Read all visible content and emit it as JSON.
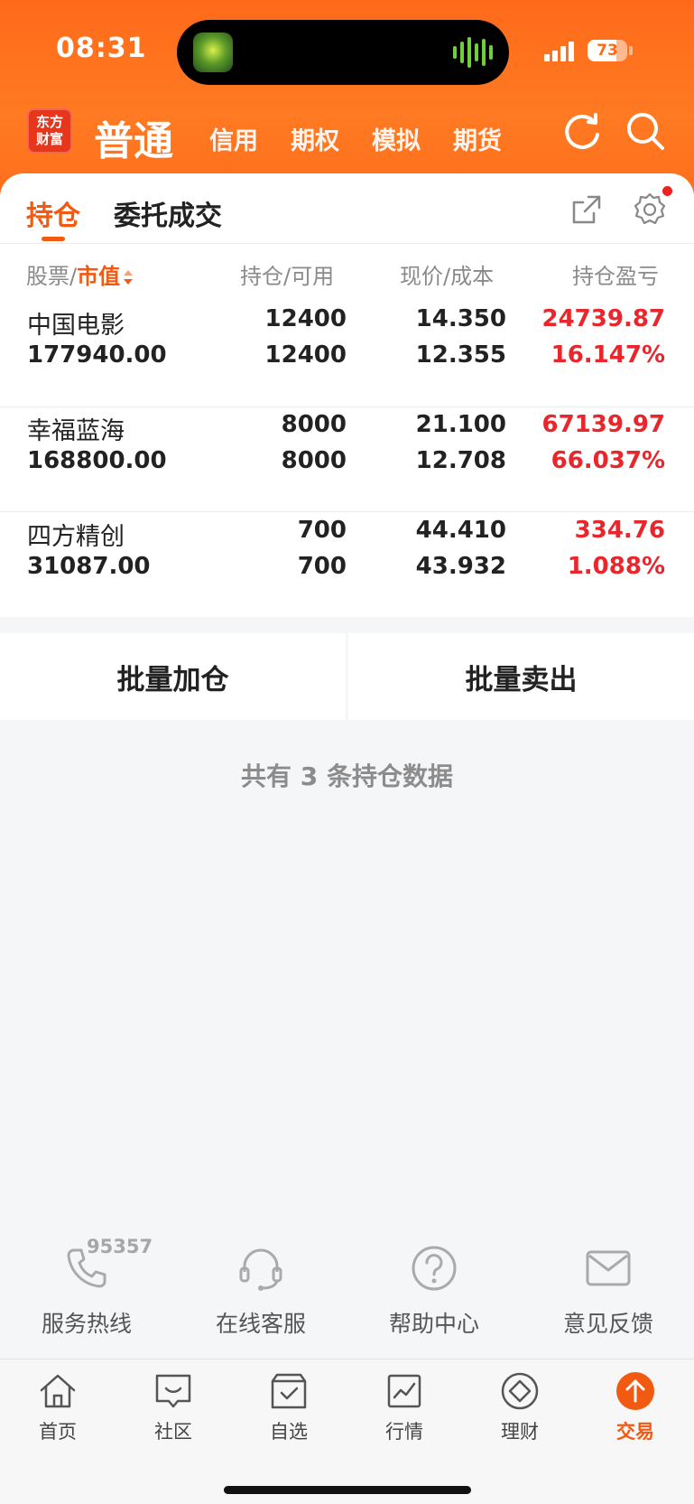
{
  "status_bar": {
    "time": "08:31",
    "battery": "73"
  },
  "header": {
    "logo_line1": "东方",
    "logo_line2": "财富",
    "tabs": [
      {
        "label": "普通",
        "active": true
      },
      {
        "label": "信用",
        "active": false
      },
      {
        "label": "期权",
        "active": false
      },
      {
        "label": "模拟",
        "active": false
      },
      {
        "label": "期货",
        "active": false
      }
    ],
    "icons": [
      "refresh-icon",
      "search-icon"
    ]
  },
  "sub_tabs": [
    {
      "label": "持仓",
      "active": true
    },
    {
      "label": "委托成交",
      "active": false
    }
  ],
  "columns": {
    "c1a": "股票",
    "c1b": "市值",
    "c2": "持仓/可用",
    "c3": "现价/成本",
    "c4": "持仓盈亏"
  },
  "positions": [
    {
      "name": "中国电影",
      "market_value": "177940.00",
      "holding": "12400",
      "available": "12400",
      "price": "14.350",
      "cost": "12.355",
      "pnl": "24739.87",
      "pnl_pct": "16.147%"
    },
    {
      "name": "幸福蓝海",
      "market_value": "168800.00",
      "holding": "8000",
      "available": "8000",
      "price": "21.100",
      "cost": "12.708",
      "pnl": "67139.97",
      "pnl_pct": "66.037%"
    },
    {
      "name": "四方精创",
      "market_value": "31087.00",
      "holding": "700",
      "available": "700",
      "price": "44.410",
      "cost": "43.932",
      "pnl": "334.76",
      "pnl_pct": "1.088%"
    }
  ],
  "actions": {
    "add": "批量加仓",
    "sell": "批量卖出"
  },
  "summary": "共有 3 条持仓数据",
  "help": {
    "hotline_number": "95357",
    "items": [
      {
        "label": "服务热线",
        "icon": "phone-icon"
      },
      {
        "label": "在线客服",
        "icon": "headset-icon"
      },
      {
        "label": "帮助中心",
        "icon": "question-icon"
      },
      {
        "label": "意见反馈",
        "icon": "mail-icon"
      }
    ]
  },
  "tabbar": [
    {
      "label": "首页",
      "icon": "home-icon",
      "active": false
    },
    {
      "label": "社区",
      "icon": "chat-icon",
      "active": false
    },
    {
      "label": "自选",
      "icon": "watchlist-icon",
      "active": false
    },
    {
      "label": "行情",
      "icon": "market-chart-icon",
      "active": false
    },
    {
      "label": "理财",
      "icon": "wealth-icon",
      "active": false
    },
    {
      "label": "交易",
      "icon": "trade-icon",
      "active": true
    }
  ],
  "colors": {
    "accent": "#f25a12",
    "header_bg": "#ff6e1c",
    "profit_red": "#e8262c"
  }
}
